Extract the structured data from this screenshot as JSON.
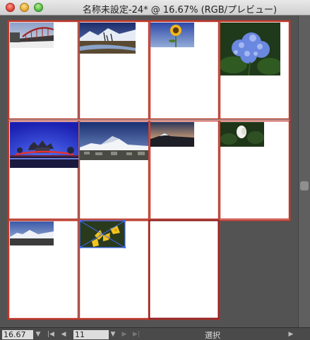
{
  "window": {
    "title": "名称未設定-24* @ 16.67% (RGB/プレビュー)"
  },
  "status_bar": {
    "zoom_value": "16.67",
    "page_value": "11",
    "tool_label": "選択",
    "first_page_icon": "first-page-icon",
    "prev_page_icon": "prev-page-icon",
    "next_page_icon": "next-page-icon",
    "last_page_icon": "last-page-icon"
  },
  "colors": {
    "artboard_border": "#c0392b",
    "active_border": "#8e1a1a",
    "selection": "#3d6fff",
    "canvas_bg": "#535353"
  },
  "artboards": [
    {
      "id": 1,
      "photo": "red-bridge"
    },
    {
      "id": 2,
      "photo": "snowy-mountain-river"
    },
    {
      "id": 3,
      "photo": "sunflower"
    },
    {
      "id": 4,
      "photo": "blue-hydrangea"
    },
    {
      "id": 5,
      "photo": "castle-night"
    },
    {
      "id": 6,
      "photo": "mount-fuji-town"
    },
    {
      "id": 7,
      "photo": "mountain-sunset"
    },
    {
      "id": 8,
      "photo": "white-flower"
    },
    {
      "id": 9,
      "photo": "snowy-peaks"
    },
    {
      "id": 10,
      "photo": "yellow-flowers",
      "selected": true
    },
    {
      "id": 11,
      "photo": "",
      "active": true
    }
  ]
}
